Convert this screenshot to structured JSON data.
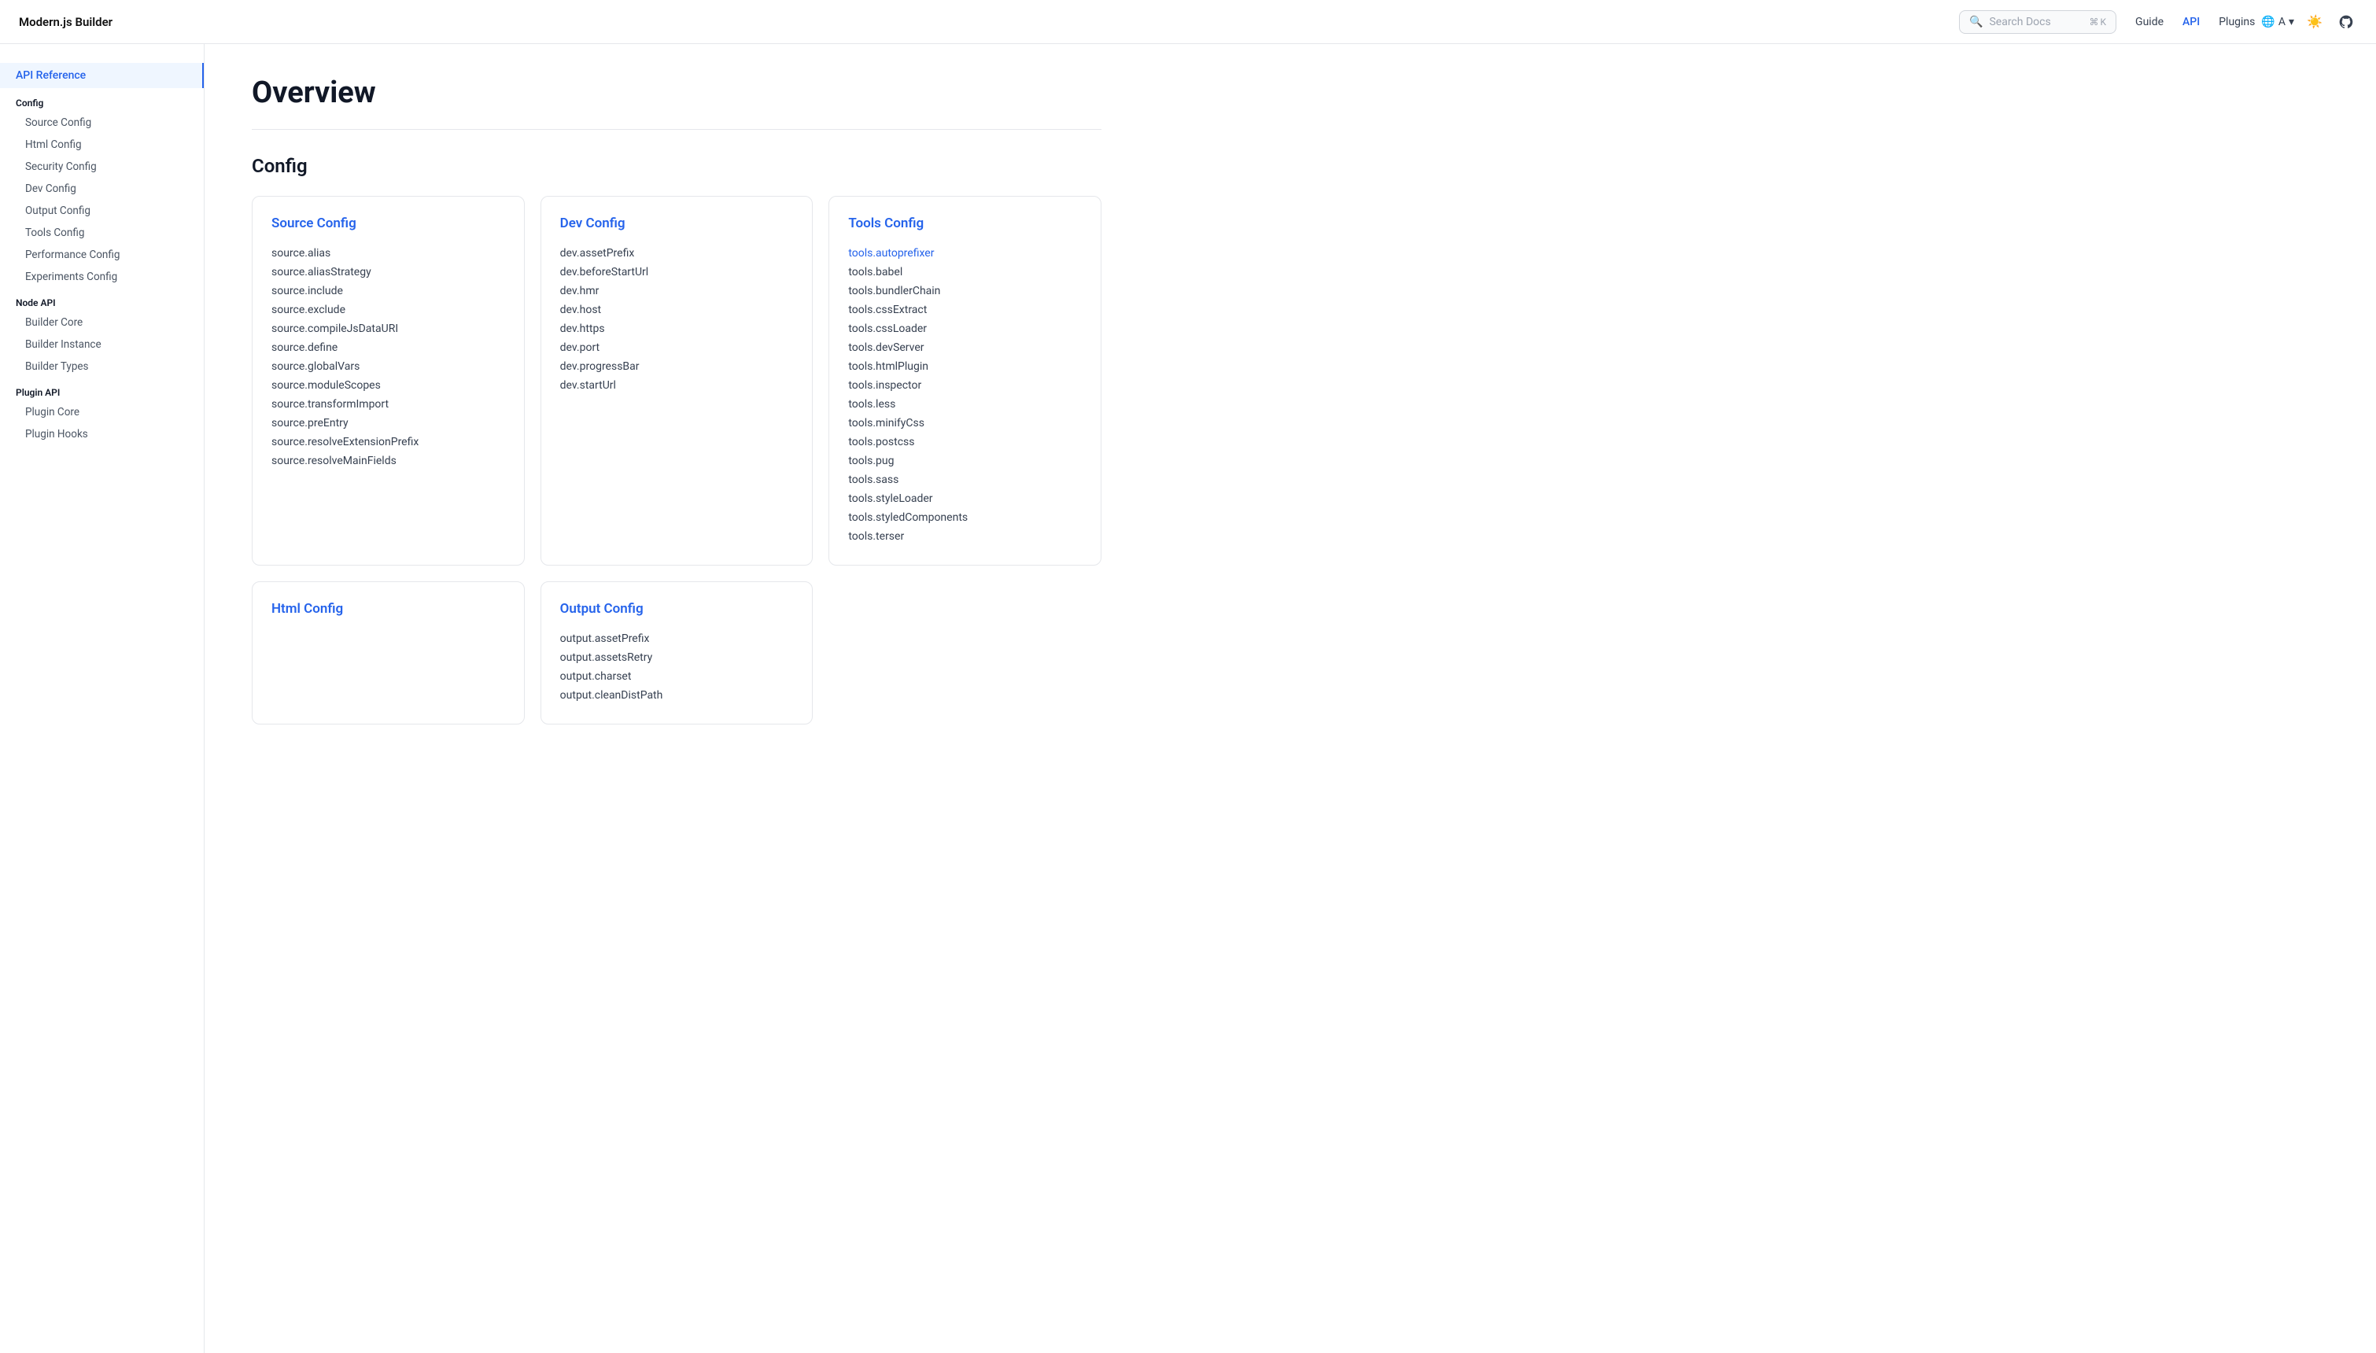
{
  "header": {
    "logo": "Modern.js Builder",
    "search_placeholder": "Search Docs",
    "search_kbd": "⌘ K",
    "nav_items": [
      {
        "label": "Guide",
        "active": false
      },
      {
        "label": "API",
        "active": true
      },
      {
        "label": "Plugins",
        "active": false
      }
    ],
    "lang_label": "A"
  },
  "sidebar": {
    "top_item": "API Reference",
    "sections": [
      {
        "title": "Config",
        "items": [
          "Source Config",
          "Html Config",
          "Security Config",
          "Dev Config",
          "Output Config",
          "Tools Config",
          "Performance Config",
          "Experiments Config"
        ]
      },
      {
        "title": "Node API",
        "items": [
          "Builder Core",
          "Builder Instance",
          "Builder Types"
        ]
      },
      {
        "title": "Plugin API",
        "items": [
          "Plugin Core",
          "Plugin Hooks"
        ]
      }
    ]
  },
  "main": {
    "page_title": "Overview",
    "config_section_title": "Config",
    "cards": [
      {
        "title": "Source Config",
        "links": [
          "source.alias",
          "source.aliasStrategy",
          "source.include",
          "source.exclude",
          "source.compileJsDataURI",
          "source.define",
          "source.globalVars",
          "source.moduleScopes",
          "source.transformImport",
          "source.preEntry",
          "source.resolveExtensionPrefix",
          "source.resolveMainFields"
        ]
      },
      {
        "title": "Dev Config",
        "links": [
          "dev.assetPrefix",
          "dev.beforeStartUrl",
          "dev.hmr",
          "dev.host",
          "dev.https",
          "dev.port",
          "dev.progressBar",
          "dev.startUrl"
        ]
      },
      {
        "title": "Tools Config",
        "links": [
          "tools.autoprefixer",
          "tools.babel",
          "tools.bundlerChain",
          "tools.cssExtract",
          "tools.cssLoader",
          "tools.devServer",
          "tools.htmlPlugin",
          "tools.inspector",
          "tools.less",
          "tools.minifyCss",
          "tools.postcss",
          "tools.pug",
          "tools.sass",
          "tools.styleLoader",
          "tools.styledComponents",
          "tools.terser"
        ],
        "highlighted": [
          "tools.autoprefixer"
        ]
      },
      {
        "title": "Html Config",
        "links": []
      },
      {
        "title": "Output Config",
        "links": [
          "output.assetPrefix",
          "output.assetsRetry",
          "output.charset",
          "output.cleanDistPath"
        ]
      }
    ]
  }
}
